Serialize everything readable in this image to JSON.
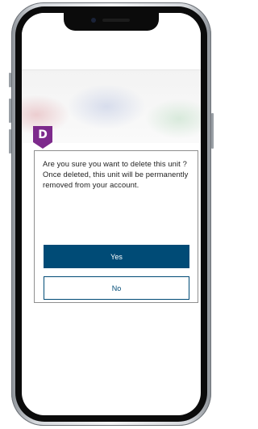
{
  "dialog": {
    "message": "Are you sure you want to delete this unit ? Once deleted, this unit will be permanently removed from your account.",
    "yes_label": "Yes",
    "no_label": "No"
  },
  "annotation": {
    "marker_label": "D",
    "marker_color": "#7d2a8c"
  },
  "colors": {
    "primary": "#004b76",
    "dialog_border": "#8f8f8f",
    "text": "#1e1e1e"
  },
  "icons": [
    "annotation-marker-icon",
    "front-camera-icon"
  ]
}
